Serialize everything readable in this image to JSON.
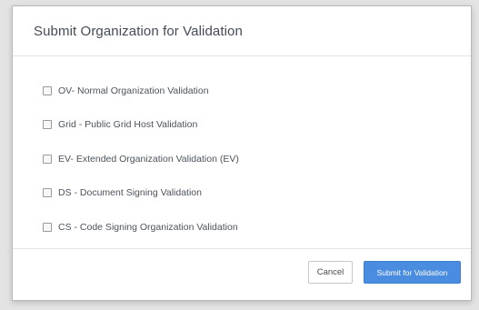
{
  "dialog": {
    "title": "Submit Organization for Validation",
    "options": [
      {
        "label": "OV- Normal Organization Validation",
        "checked": false
      },
      {
        "label": "Grid - Public Grid Host Validation",
        "checked": false
      },
      {
        "label": "EV- Extended Organization Validation (EV)",
        "checked": false
      },
      {
        "label": "DS - Document Signing Validation",
        "checked": false
      },
      {
        "label": "CS - Code Signing Organization Validation",
        "checked": false
      }
    ],
    "buttons": {
      "cancel_label": "Cancel",
      "submit_label": "Submit for Validation"
    }
  },
  "colors": {
    "primary": "#4a8cdf",
    "title_text": "#444b55"
  }
}
